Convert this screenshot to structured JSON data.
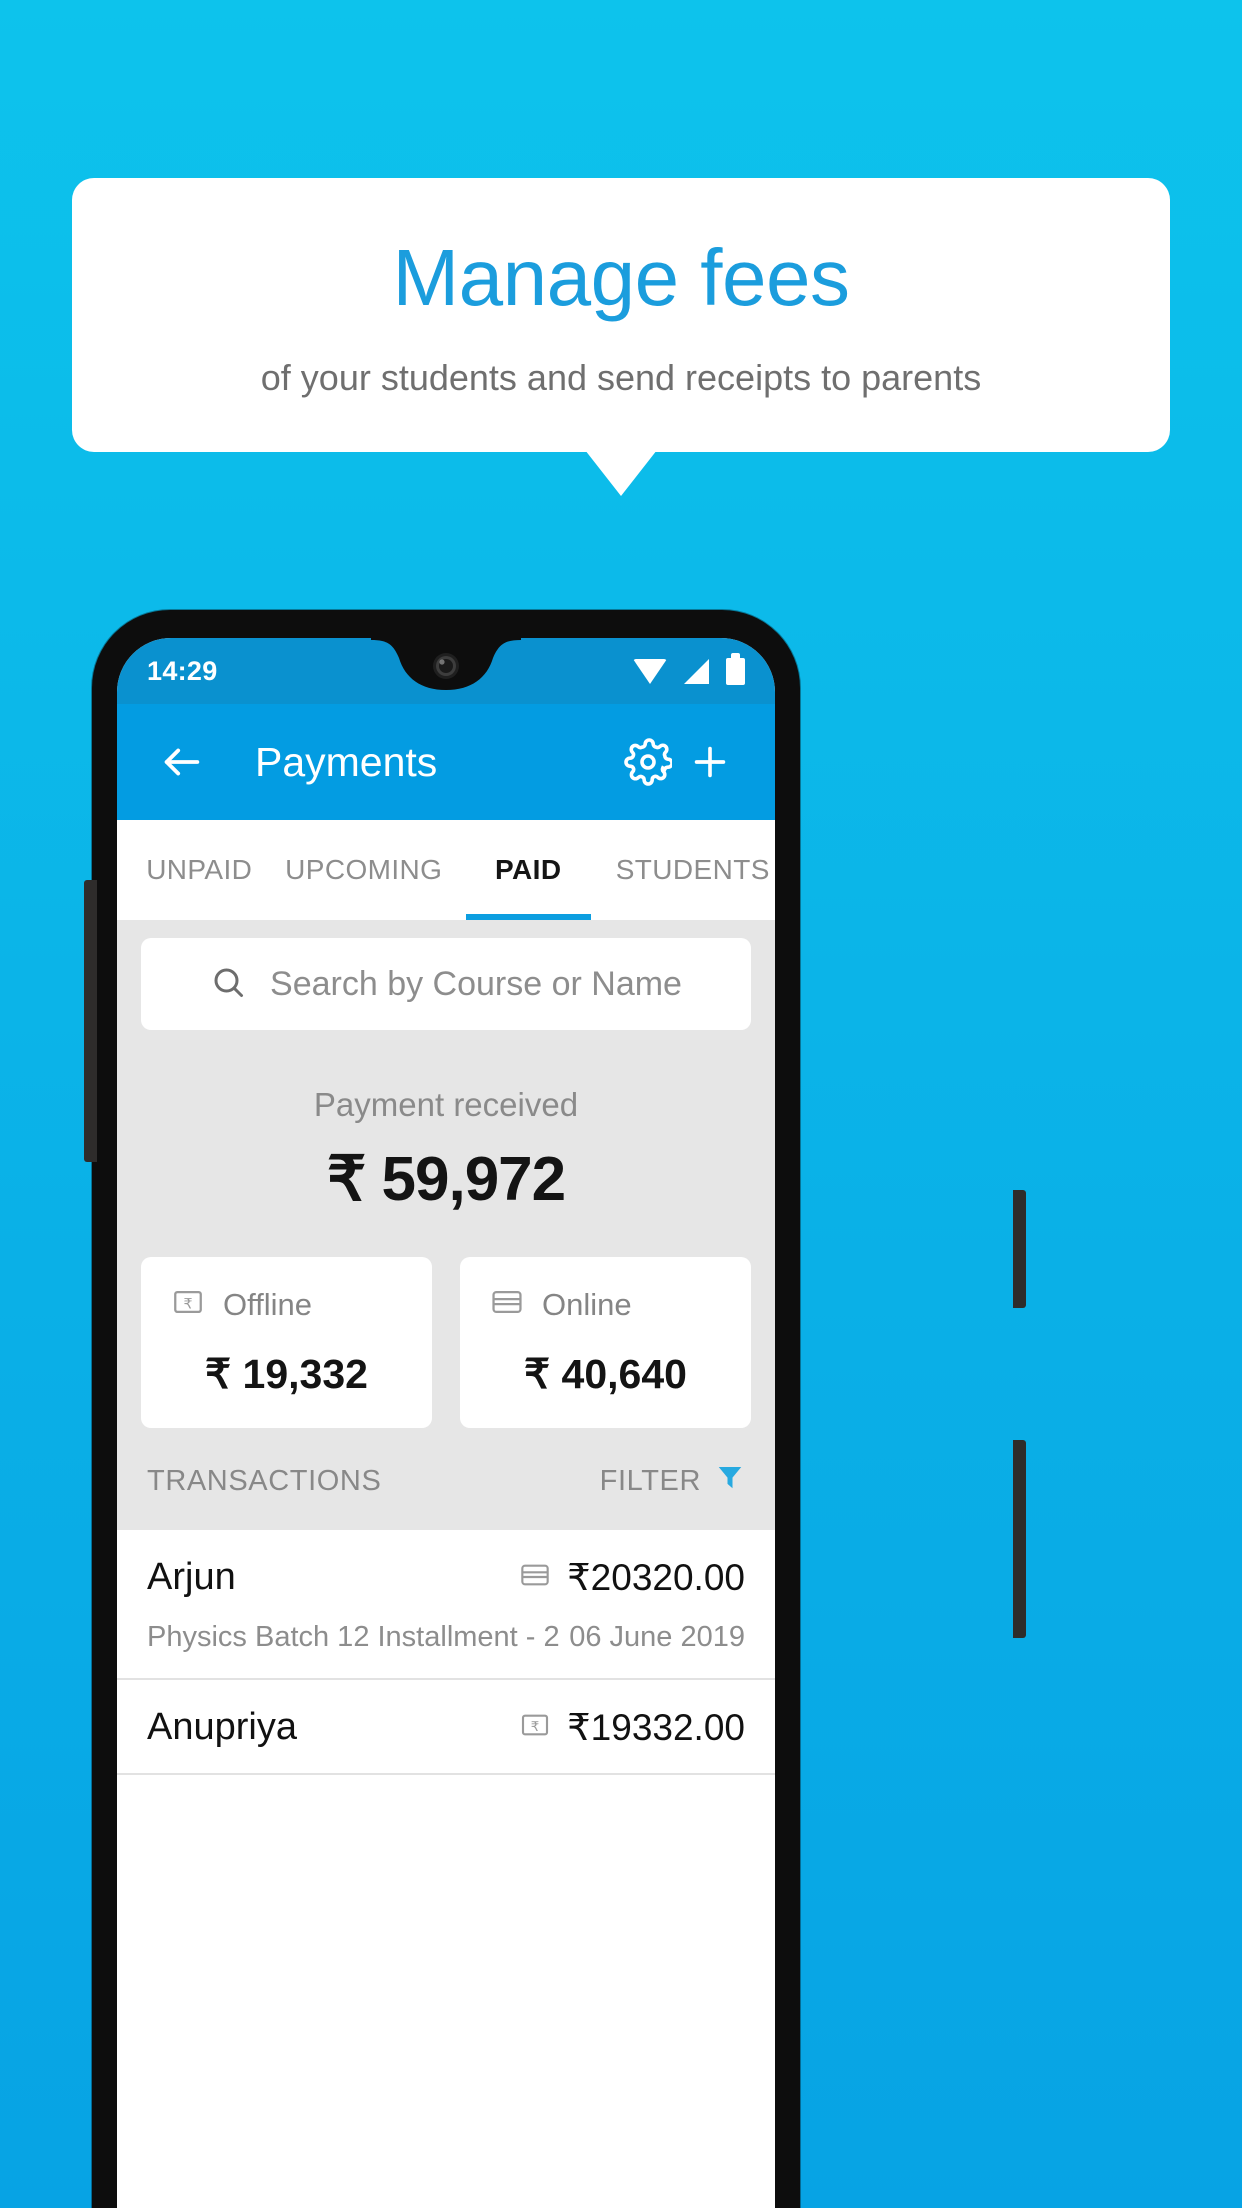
{
  "promo": {
    "title": "Manage fees",
    "subtitle": "of your students and send receipts to parents",
    "title_color": "#1b9ddd",
    "subtitle_color": "#6f6f6f"
  },
  "phone": {
    "statusbar": {
      "time": "14:29",
      "icons": [
        "wifi-icon",
        "signal-icon",
        "battery-icon"
      ]
    },
    "appbar": {
      "back_icon": "back-arrow-icon",
      "title": "Payments",
      "settings_icon": "gear-icon",
      "add_icon": "plus-icon",
      "background": "#039ce2"
    },
    "tabs": [
      {
        "label": "UNPAID",
        "active": false
      },
      {
        "label": "UPCOMING",
        "active": false
      },
      {
        "label": "PAID",
        "active": true
      },
      {
        "label": "STUDENTS",
        "active": false
      }
    ],
    "search": {
      "icon": "search-icon",
      "placeholder": "Search by Course or Name",
      "value": ""
    },
    "summary": {
      "label": "Payment received",
      "amount": "₹ 59,972",
      "breakdown": [
        {
          "icon": "banknote-icon",
          "label": "Offline",
          "amount": "₹ 19,332"
        },
        {
          "icon": "credit-card-icon",
          "label": "Online",
          "amount": "₹ 40,640"
        }
      ]
    },
    "transactions_header": {
      "title": "TRANSACTIONS",
      "filter_label": "FILTER",
      "filter_icon": "funnel-icon",
      "filter_color": "#27a9e0"
    },
    "transactions": [
      {
        "name": "Arjun",
        "icon": "credit-card-icon",
        "amount": "₹20320.00",
        "description": "Physics Batch 12 Installment - 2",
        "date": "06 June 2019"
      },
      {
        "name": "Anupriya",
        "icon": "banknote-icon",
        "amount": "₹19332.00",
        "description": "",
        "date": ""
      }
    ]
  }
}
